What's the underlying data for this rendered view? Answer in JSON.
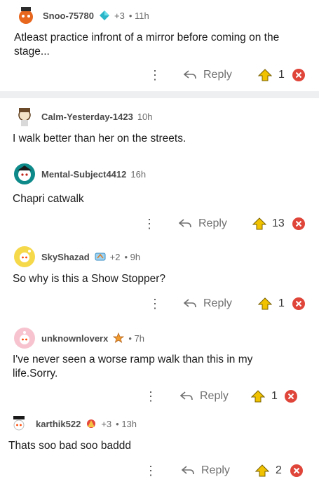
{
  "comments": [
    {
      "user": "Snoo-75780",
      "awards": "+3",
      "time": "• 11h",
      "text": "Atleast practice infront of a mirror before coming on the stage...",
      "reply": "Reply",
      "votes": "1"
    },
    {
      "user": "Calm-Yesterday-1423",
      "time": "10h",
      "text": "I walk better than her on the streets."
    },
    {
      "user": "Mental-Subject4412",
      "time": "16h",
      "text": "Chapri catwalk",
      "reply": "Reply",
      "votes": "13"
    },
    {
      "user": "SkyShazad",
      "awards": "+2",
      "time": "• 9h",
      "text": "So why is this a Show Stopper?",
      "reply": "Reply",
      "votes": "1"
    },
    {
      "user": "unknownloverx",
      "time": "• 7h",
      "text": "I've never seen a worse ramp walk than this in my life.Sorry.",
      "reply": "Reply",
      "votes": "1"
    },
    {
      "user": "karthik522",
      "awards": "+3",
      "time": "• 13h",
      "text": "Thats soo bad soo baddd",
      "reply": "Reply",
      "votes": "2"
    }
  ],
  "icons": {
    "more": "more-options-icon",
    "reply": "reply-arrow-icon",
    "upvote": "upvote-icon",
    "downvote": "downvote-icon"
  },
  "colors": {
    "upvote": "#f0c200",
    "downvote": "#e0453a",
    "meta": "#6a6a6a"
  }
}
